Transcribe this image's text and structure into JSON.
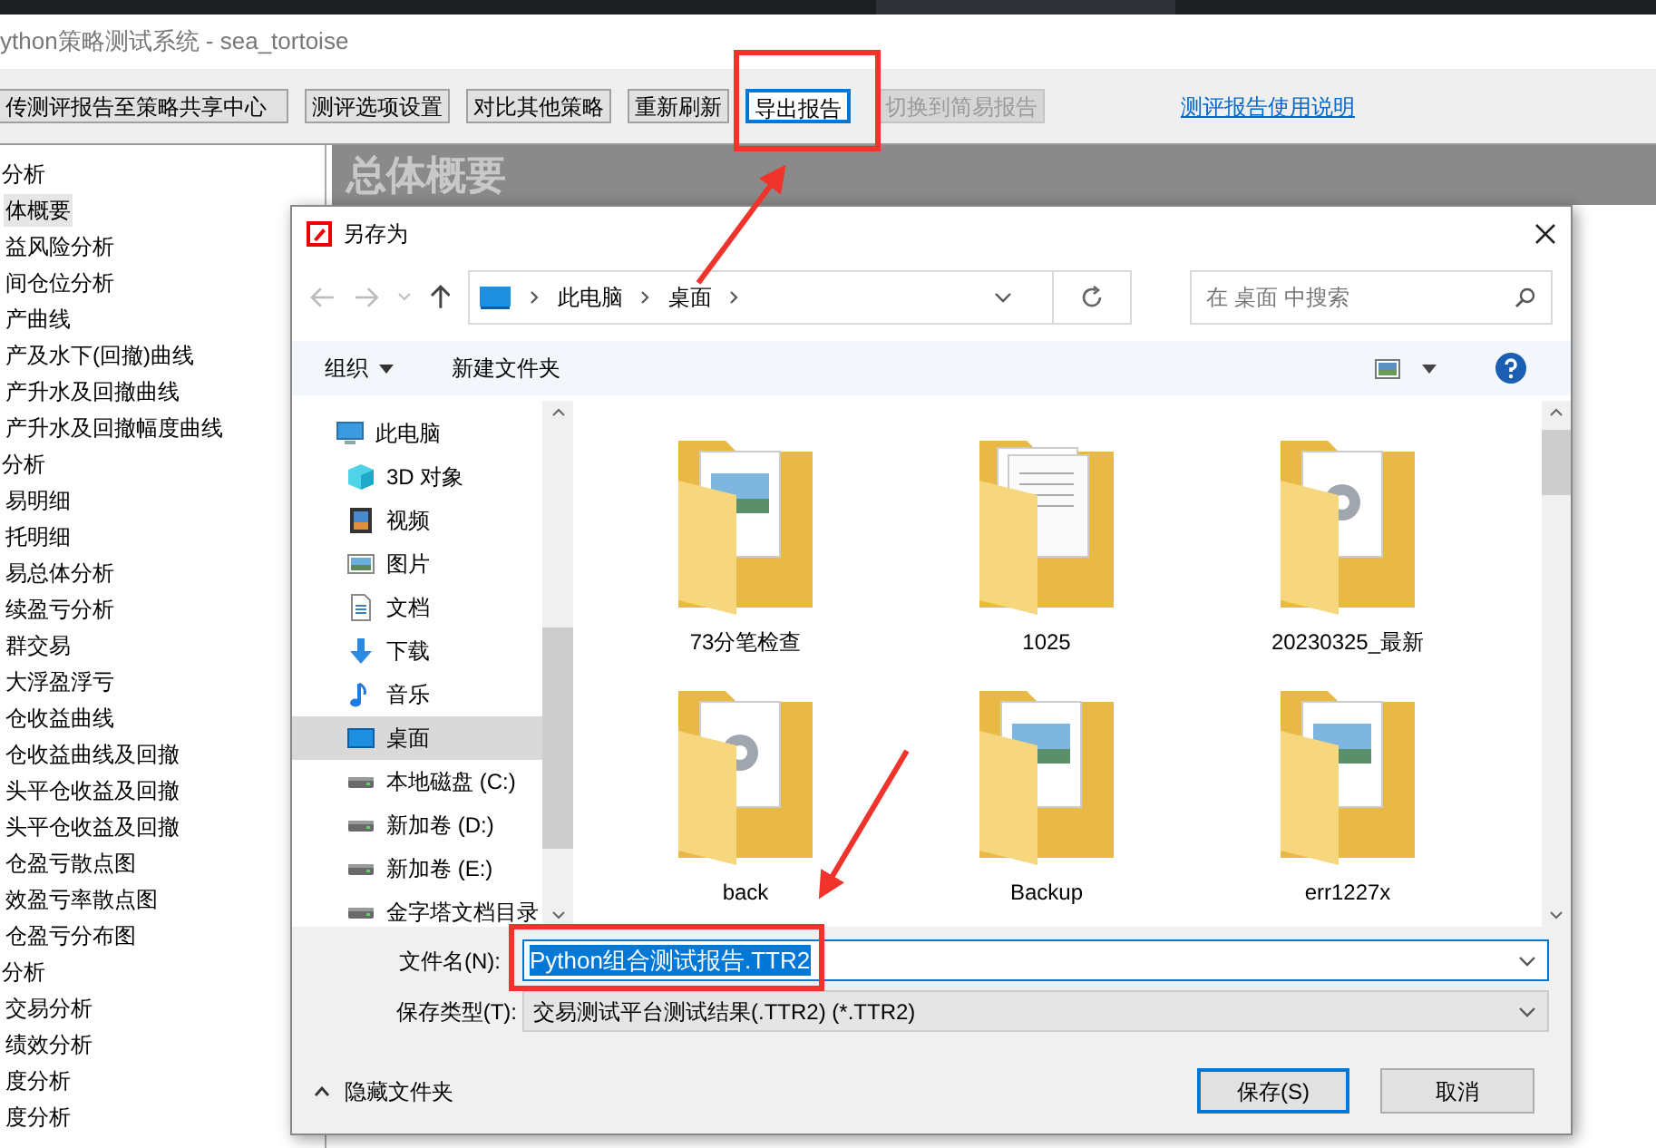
{
  "app": {
    "title": "ython策略测试系统 - sea_tortoise",
    "toolbar": [
      {
        "label": "传测评报告至策略共享中心",
        "kind": "button",
        "disabled": false,
        "focused": false
      },
      {
        "label": "测评选项设置",
        "kind": "button",
        "disabled": false,
        "focused": false
      },
      {
        "label": "对比其他策略",
        "kind": "button",
        "disabled": false,
        "focused": false
      },
      {
        "label": "重新刷新",
        "kind": "button",
        "disabled": false,
        "focused": false
      },
      {
        "label": "导出报告",
        "kind": "button",
        "disabled": false,
        "focused": true
      },
      {
        "label": "切换到简易报告",
        "kind": "button",
        "disabled": true,
        "focused": false
      },
      {
        "label": "测评报告使用说明",
        "kind": "link"
      }
    ],
    "tree": [
      {
        "label": "分析",
        "selected": false,
        "children": [
          {
            "label": "体概要",
            "selected": true
          },
          {
            "label": "益风险分析",
            "selected": false
          },
          {
            "label": "间仓位分析",
            "selected": false
          },
          {
            "label": "产曲线",
            "selected": false
          },
          {
            "label": "产及水下(回撤)曲线",
            "selected": false
          },
          {
            "label": "产升水及回撤曲线",
            "selected": false
          },
          {
            "label": "产升水及回撤幅度曲线",
            "selected": false
          }
        ]
      },
      {
        "label": "分析",
        "selected": false,
        "children": [
          {
            "label": "易明细",
            "selected": false
          },
          {
            "label": "托明细",
            "selected": false
          },
          {
            "label": "易总体分析",
            "selected": false
          },
          {
            "label": "续盈亏分析",
            "selected": false
          },
          {
            "label": "群交易",
            "selected": false
          },
          {
            "label": "大浮盈浮亏",
            "selected": false
          },
          {
            "label": "仓收益曲线",
            "selected": false
          },
          {
            "label": "仓收益曲线及回撤",
            "selected": false
          },
          {
            "label": "头平仓收益及回撤",
            "selected": false
          },
          {
            "label": "头平仓收益及回撤",
            "selected": false
          },
          {
            "label": "仓盈亏散点图",
            "selected": false
          },
          {
            "label": "效盈亏率散点图",
            "selected": false
          },
          {
            "label": "仓盈亏分布图",
            "selected": false
          }
        ]
      },
      {
        "label": "分析",
        "selected": false,
        "children": [
          {
            "label": "交易分析",
            "selected": false
          },
          {
            "label": "绩效分析",
            "selected": false
          },
          {
            "label": "度分析",
            "selected": false
          },
          {
            "label": "度分析",
            "selected": false
          }
        ]
      }
    ],
    "content_heading": "总体概要"
  },
  "dialog": {
    "title": "另存为",
    "breadcrumb": [
      "此电脑",
      "桌面"
    ],
    "search": {
      "placeholder": "在 桌面 中搜索"
    },
    "organize": "组织",
    "new_folder": "新建文件夹",
    "nav": [
      {
        "label": "此电脑",
        "kind": "pc",
        "selected": false
      },
      {
        "label": "3D 对象",
        "kind": "cube",
        "selected": false
      },
      {
        "label": "视频",
        "kind": "video",
        "selected": false
      },
      {
        "label": "图片",
        "kind": "image",
        "selected": false
      },
      {
        "label": "文档",
        "kind": "doc",
        "selected": false
      },
      {
        "label": "下载",
        "kind": "download",
        "selected": false
      },
      {
        "label": "音乐",
        "kind": "music",
        "selected": false
      },
      {
        "label": "桌面",
        "kind": "desktop",
        "selected": true
      },
      {
        "label": "本地磁盘 (C:)",
        "kind": "drive",
        "selected": false
      },
      {
        "label": "新加卷 (D:)",
        "kind": "drive",
        "selected": false
      },
      {
        "label": "新加卷 (E:)",
        "kind": "drive",
        "selected": false
      },
      {
        "label": "金字塔文档目录",
        "kind": "drive",
        "selected": false
      }
    ],
    "files": [
      {
        "name": "73分笔检查",
        "kind": "image"
      },
      {
        "name": "1025",
        "kind": "papers"
      },
      {
        "name": "20230325_最新",
        "kind": "gear"
      },
      {
        "name": "back",
        "kind": "gear"
      },
      {
        "name": "Backup",
        "kind": "image"
      },
      {
        "name": "err1227x",
        "kind": "image"
      }
    ],
    "filename_label": "文件名(N):",
    "filename": "Python组合测试报告.TTR2",
    "filetype_label": "保存类型(T):",
    "filetype": "交易测试平台测试结果(.TTR2) (*.TTR2)",
    "hide_folders": "隐藏文件夹",
    "save": "保存(S)",
    "cancel": "取消"
  }
}
